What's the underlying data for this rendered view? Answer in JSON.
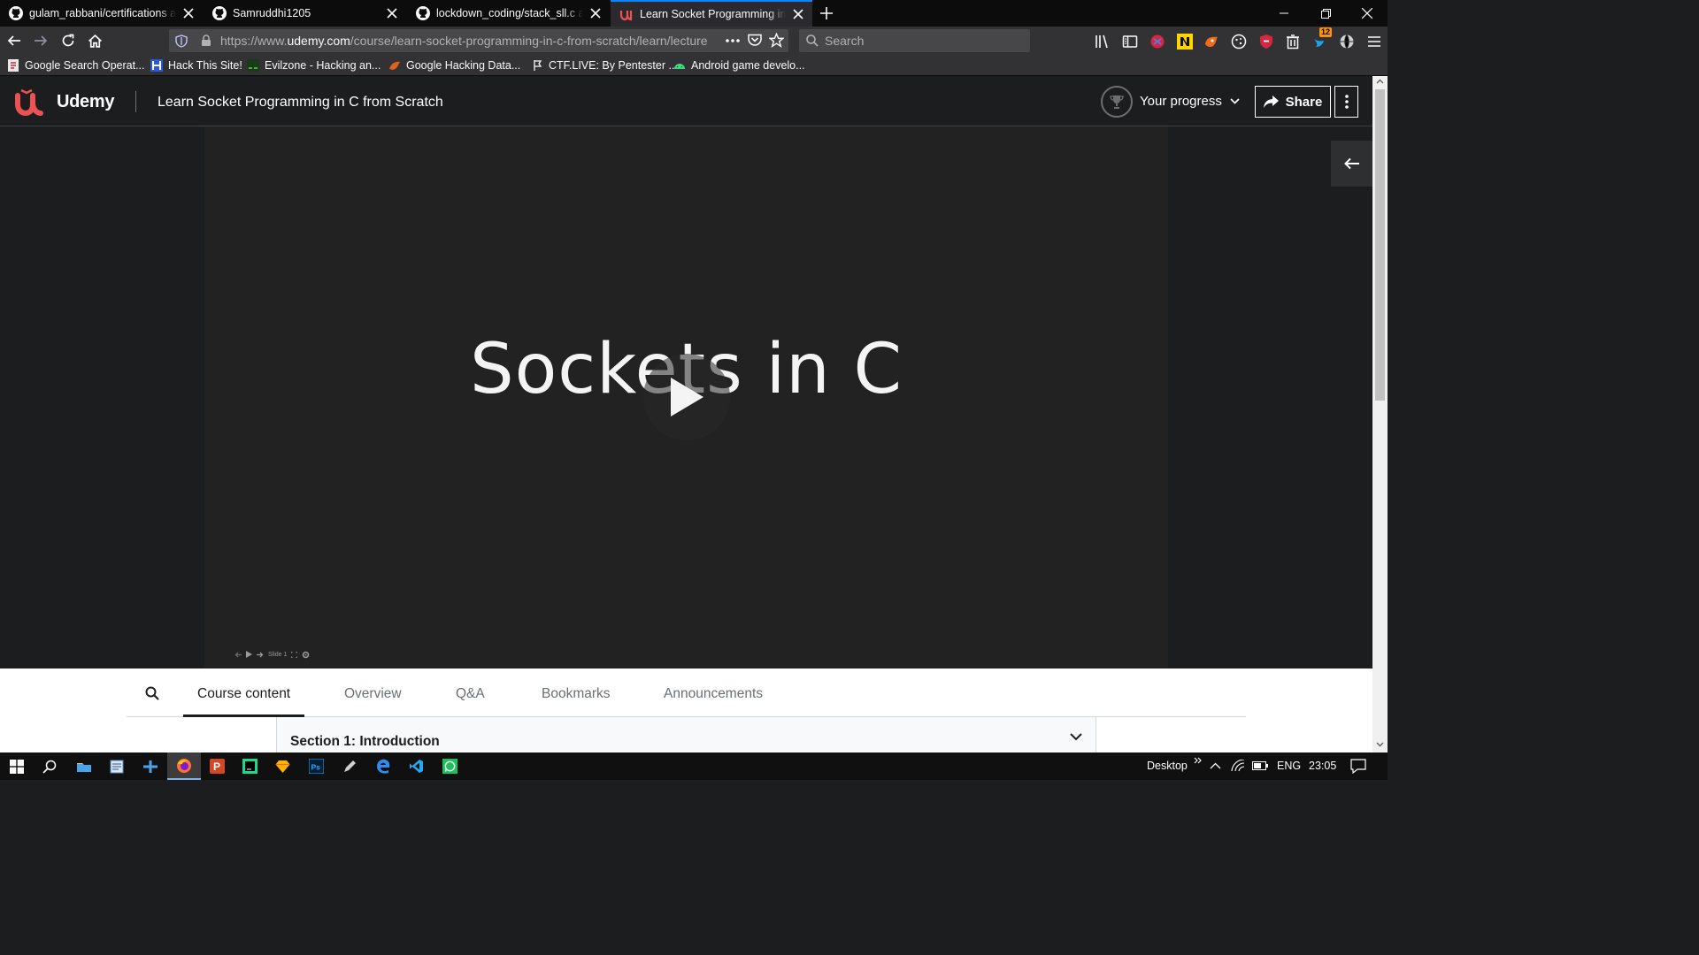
{
  "browser": {
    "tabs": [
      {
        "label": "gulam_rabbani/certifications at master",
        "icon": "github-icon"
      },
      {
        "label": "Samruddhi1205",
        "icon": "github-icon"
      },
      {
        "label": "lockdown_coding/stack_sll.c at master",
        "icon": "github-icon"
      },
      {
        "label": "Learn Socket Programming in C from Scratch",
        "icon": "udemy-icon"
      }
    ],
    "url_prefix": "https://www.",
    "url_domain": "udemy.com",
    "url_path": "/course/learn-socket-programming-in-c-from-scratch/learn/lecture",
    "search_placeholder": "Search",
    "bookmarks": [
      {
        "label": "Google Search Operat...",
        "icon": "page-icon"
      },
      {
        "label": "Hack This Site!",
        "icon": "hts-icon"
      },
      {
        "label": "Evilzone - Hacking an...",
        "icon": "evilzone-icon"
      },
      {
        "label": "Google Hacking Data...",
        "icon": "ghdb-icon"
      },
      {
        "label": "CTF.LIVE: By Pentester ...",
        "icon": "ctf-icon"
      },
      {
        "label": "Android game develo...",
        "icon": "android-icon"
      }
    ],
    "notification_count": "12"
  },
  "udemy": {
    "brand": "Udemy",
    "course_title": "Learn Socket Programming in C from Scratch",
    "progress_label": "Your progress",
    "share_label": "Share"
  },
  "video": {
    "slide_title": "Sockets in C",
    "slide_label": "Slide 1"
  },
  "content_tabs": [
    "Course content",
    "Overview",
    "Q&A",
    "Bookmarks",
    "Announcements"
  ],
  "active_tab": "Course content",
  "section": {
    "title": "Section 1: Introduction"
  },
  "taskbar": {
    "desktop_label": "Desktop",
    "language": "ENG",
    "time": "23:05"
  },
  "colors": {
    "accent": "#0a84ff",
    "udemy_red": "#ec5252",
    "dark_bg": "#1c1d1f"
  }
}
